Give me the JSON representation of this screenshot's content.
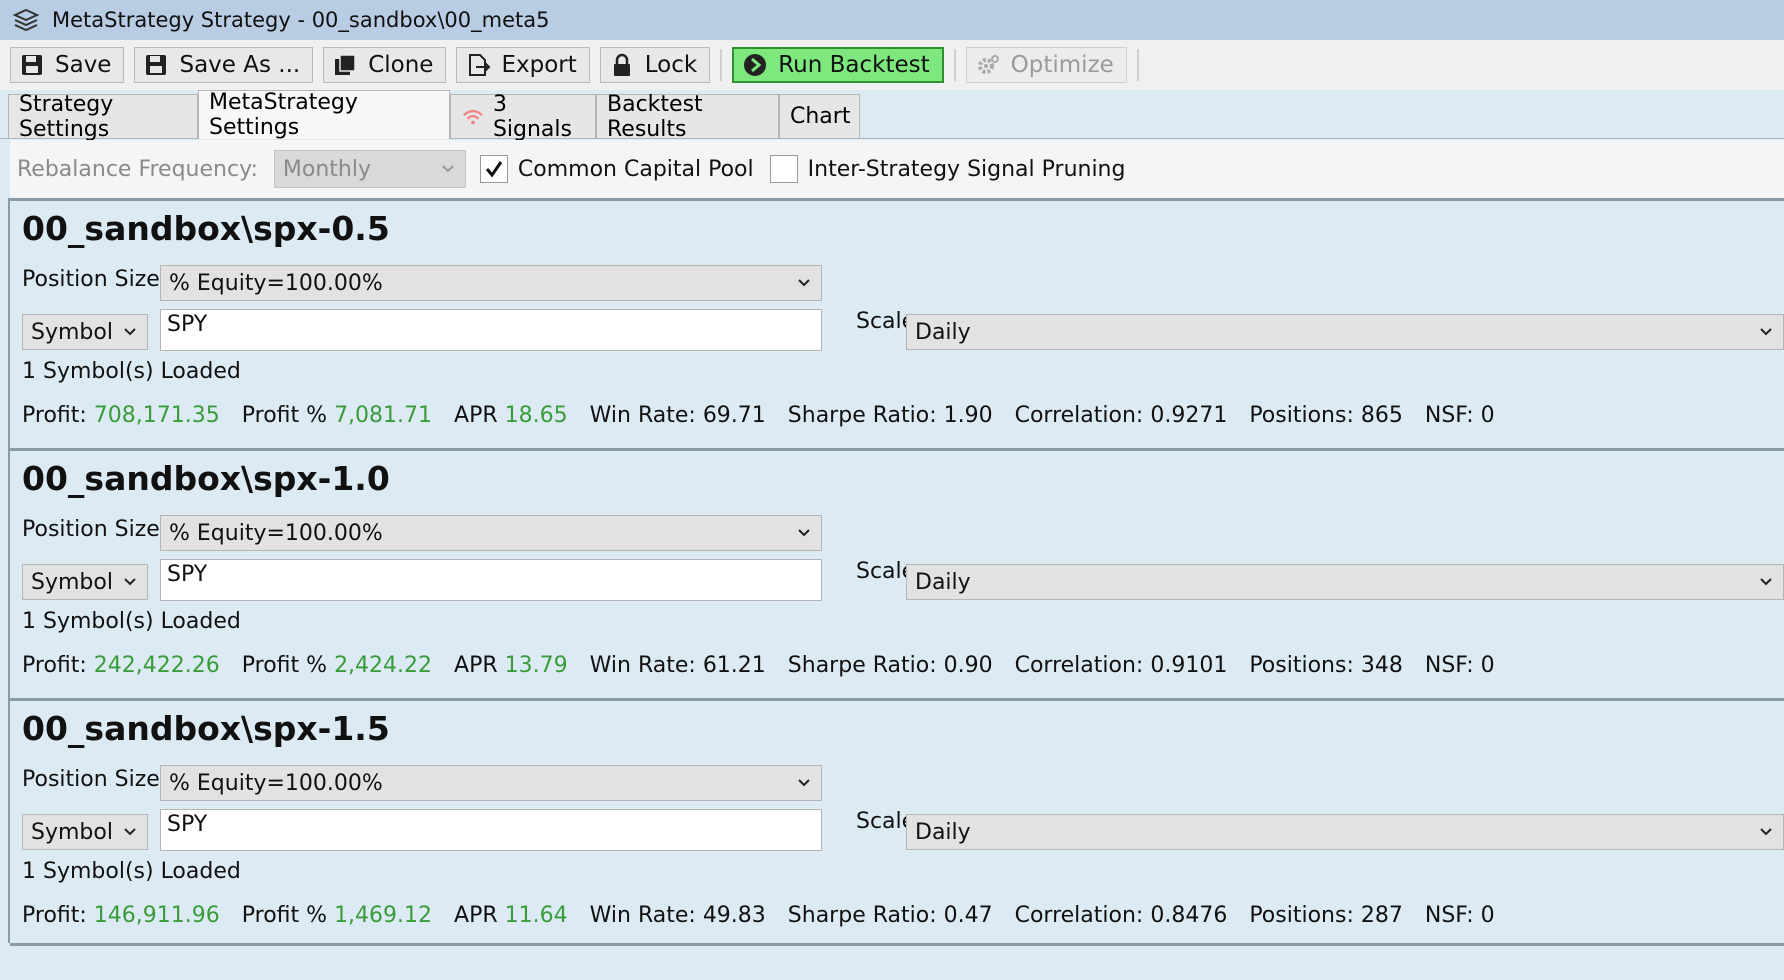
{
  "window": {
    "title": "MetaStrategy Strategy - 00_sandbox\\00_meta5"
  },
  "toolbar": {
    "save": "Save",
    "save_as": "Save As ...",
    "clone": "Clone",
    "export": "Export",
    "lock": "Lock",
    "run_backtest": "Run Backtest",
    "optimize": "Optimize"
  },
  "tabs": [
    {
      "label": "Strategy Settings"
    },
    {
      "label": "MetaStrategy Settings",
      "active": true
    },
    {
      "label": "3 Signals",
      "icon": "wifi-signal-icon"
    },
    {
      "label": "Backtest Results"
    },
    {
      "label": "Chart"
    }
  ],
  "options": {
    "rebalance_label": "Rebalance Frequency:",
    "rebalance_value": "Monthly",
    "common_capital_pool": "Common Capital Pool",
    "common_capital_pool_checked": true,
    "signal_pruning": "Inter-Strategy Signal Pruning",
    "signal_pruning_checked": false
  },
  "labels": {
    "position_size": "Position Size",
    "symbol_mode": "Symbol",
    "scale": "Scale",
    "profit": "Profit:",
    "profit_pct": "Profit %",
    "apr": "APR",
    "win_rate": "Win Rate:",
    "sharpe": "Sharpe Ratio:",
    "correlation": "Correlation:",
    "positions": "Positions:",
    "nsf": "NSF:"
  },
  "colors": {
    "positive": "#3a9b3a",
    "run_button": "#7ee87e"
  },
  "strategies": [
    {
      "name": "00_sandbox\\spx-0.5",
      "position_size": "% Equity=100.00%",
      "symbols": "SPY",
      "scale": "Daily",
      "loaded": "1 Symbol(s) Loaded",
      "profit": "708,171.35",
      "profit_pct": "7,081.71",
      "apr": "18.65",
      "win_rate": "69.71",
      "sharpe": "1.90",
      "correlation": "0.9271",
      "positions": "865",
      "nsf": "0"
    },
    {
      "name": "00_sandbox\\spx-1.0",
      "position_size": "% Equity=100.00%",
      "symbols": "SPY",
      "scale": "Daily",
      "loaded": "1 Symbol(s) Loaded",
      "profit": "242,422.26",
      "profit_pct": "2,424.22",
      "apr": "13.79",
      "win_rate": "61.21",
      "sharpe": "0.90",
      "correlation": "0.9101",
      "positions": "348",
      "nsf": "0"
    },
    {
      "name": "00_sandbox\\spx-1.5",
      "position_size": "% Equity=100.00%",
      "symbols": "SPY",
      "scale": "Daily",
      "loaded": "1 Symbol(s) Loaded",
      "profit": "146,911.96",
      "profit_pct": "1,469.12",
      "apr": "11.64",
      "win_rate": "49.83",
      "sharpe": "0.47",
      "correlation": "0.8476",
      "positions": "287",
      "nsf": "0"
    }
  ]
}
